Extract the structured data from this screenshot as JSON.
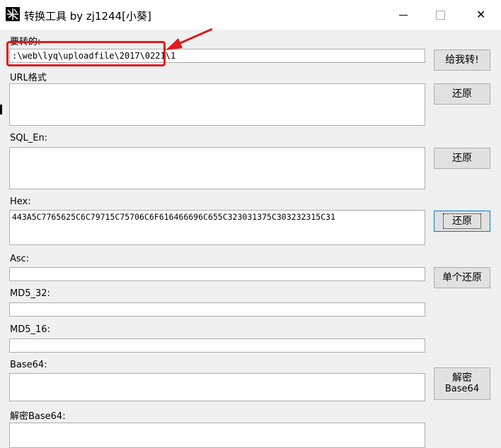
{
  "window": {
    "title": "转换工具 by zj1244[小葵]",
    "close_glyph": "✕"
  },
  "fields": {
    "to_convert": {
      "label": "要转的:",
      "value": ":\\web\\lyq\\uploadfile\\2017\\0221\\1"
    },
    "url": {
      "label": "URL格式",
      "value": ""
    },
    "sql_en": {
      "label": "SQL_En:",
      "value": ""
    },
    "hex": {
      "label": "Hex:",
      "value": "443A5C7765625C6C79715C75706C6F616466696C655C323031375C303232315C31"
    },
    "asc": {
      "label": "Asc:",
      "value": ""
    },
    "md5_32": {
      "label": "MD5_32:",
      "value": ""
    },
    "md5_16": {
      "label": "MD5_16:",
      "value": ""
    },
    "base64": {
      "label": "Base64:",
      "value": ""
    },
    "decode_base64": {
      "label": "解密Base64:",
      "value": ""
    }
  },
  "buttons": {
    "convert": "给我转!",
    "restore_url": "还原",
    "restore_sql": "还原",
    "restore_hex": "还原",
    "restore_single": "单个还原",
    "decrypt_line1": "解密",
    "decrypt_line2": "Base64"
  },
  "colors": {
    "highlight": "#e0191b",
    "focus": "#0078d7"
  }
}
